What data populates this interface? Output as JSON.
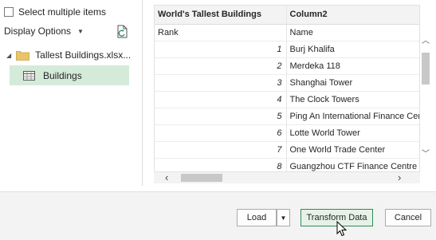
{
  "navigator": {
    "select_multiple_label": "Select multiple items",
    "display_options_label": "Display Options",
    "file_name": "Tallest Buildings.xlsx...",
    "sheet_name": "Buildings"
  },
  "preview": {
    "columns": [
      "World's Tallest Buildings",
      "Column2"
    ],
    "subheader": [
      "Rank",
      "Name"
    ],
    "rows": [
      {
        "rank": "1",
        "name": "Burj Khalifa"
      },
      {
        "rank": "2",
        "name": "Merdeka 118"
      },
      {
        "rank": "3",
        "name": "Shanghai Tower"
      },
      {
        "rank": "4",
        "name": "The Clock Towers"
      },
      {
        "rank": "5",
        "name": "Ping An International Finance Centre"
      },
      {
        "rank": "6",
        "name": "Lotte World Tower"
      },
      {
        "rank": "7",
        "name": "One World Trade Center"
      },
      {
        "rank": "8",
        "name": "Guangzhou CTF Finance Centre"
      }
    ]
  },
  "footer": {
    "load_label": "Load",
    "transform_label": "Transform Data",
    "cancel_label": "Cancel"
  },
  "colors": {
    "selected_bg": "#d4ebd9",
    "accent_green": "#2e8b57",
    "footer_bg": "#f3f3f3"
  }
}
